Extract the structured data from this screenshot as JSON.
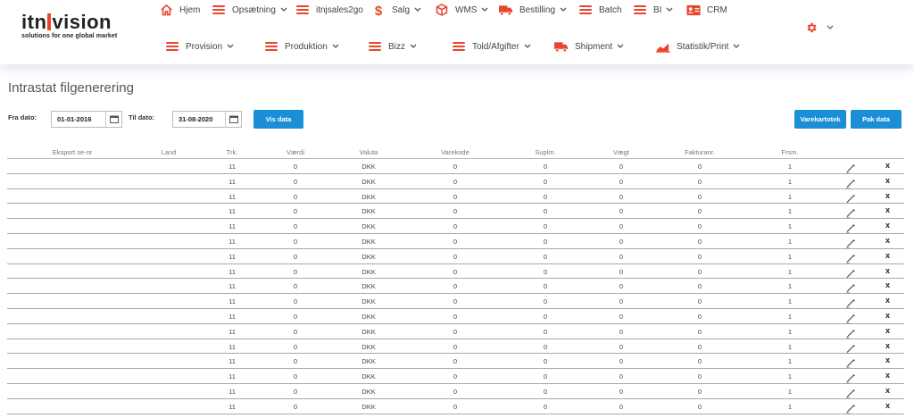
{
  "logo": {
    "brand_left": "itn",
    "brand_right": "vision",
    "tagline": "solutions for one global market"
  },
  "nav": {
    "row1": [
      {
        "label": "Hjem",
        "icon": "home-icon",
        "chevron": false
      },
      {
        "label": "Opsætning",
        "icon": "menu-icon",
        "chevron": true
      },
      {
        "label": "itnjsales2go",
        "icon": "menu-icon",
        "chevron": false
      },
      {
        "label": "Salg",
        "icon": "dollar-icon",
        "chevron": true
      },
      {
        "label": "WMS",
        "icon": "box-icon",
        "chevron": true
      },
      {
        "label": "Bestilling",
        "icon": "truck-icon",
        "chevron": true
      },
      {
        "label": "Batch",
        "icon": "menu-icon",
        "chevron": false
      },
      {
        "label": "BI",
        "icon": "menu-icon",
        "chevron": true
      },
      {
        "label": "CRM",
        "icon": "contact-card-icon",
        "chevron": false
      }
    ],
    "row2": [
      {
        "label": "Provision",
        "icon": "menu-icon",
        "chevron": true
      },
      {
        "label": "Produktion",
        "icon": "menu-icon",
        "chevron": true
      },
      {
        "label": "Bizz",
        "icon": "menu-icon",
        "chevron": true
      },
      {
        "label": "Told/Afgifter",
        "icon": "menu-icon",
        "chevron": true
      },
      {
        "label": "Shipment",
        "icon": "truck-icon",
        "chevron": true
      },
      {
        "label": "Statistik/Print",
        "icon": "chart-icon",
        "chevron": true
      }
    ]
  },
  "accent_color": "#e8452e",
  "button_color": "#1a8fd8",
  "page_title": "Intrastat filgenerering",
  "filters": {
    "from_label": "Fra dato:",
    "from_value": "01-01-2016",
    "to_label": "Til dato:",
    "to_value": "31-08-2020",
    "show_button": "Vis data",
    "varekartotek_button": "Varekartotek",
    "pak_button": "Pak data"
  },
  "table": {
    "headers": [
      "Eksport se-nr",
      "Land",
      "Trk.",
      "Værdi",
      "Valuta",
      "Varekode",
      "Suplm.",
      "Vægt",
      "Fakturanr.",
      "Frsm."
    ],
    "rows": [
      [
        "",
        "",
        "11",
        "0",
        "DKK",
        "0",
        "0",
        "0",
        "0",
        "1"
      ],
      [
        "",
        "",
        "11",
        "0",
        "DKK",
        "0",
        "0",
        "0",
        "0",
        "1"
      ],
      [
        "",
        "",
        "11",
        "0",
        "DKK",
        "0",
        "0",
        "0",
        "0",
        "1"
      ],
      [
        "",
        "",
        "11",
        "0",
        "DKK",
        "0",
        "0",
        "0",
        "0",
        "1"
      ],
      [
        "",
        "",
        "11",
        "0",
        "DKK",
        "0",
        "0",
        "0",
        "0",
        "1"
      ],
      [
        "",
        "",
        "11",
        "0",
        "DKK",
        "0",
        "0",
        "0",
        "0",
        "1"
      ],
      [
        "",
        "",
        "11",
        "0",
        "DKK",
        "0",
        "0",
        "0",
        "0",
        "1"
      ],
      [
        "",
        "",
        "11",
        "0",
        "DKK",
        "0",
        "0",
        "0",
        "0",
        "1"
      ],
      [
        "",
        "",
        "11",
        "0",
        "DKK",
        "0",
        "0",
        "0",
        "0",
        "1"
      ],
      [
        "",
        "",
        "11",
        "0",
        "DKK",
        "0",
        "0",
        "0",
        "0",
        "1"
      ],
      [
        "",
        "",
        "11",
        "0",
        "DKK",
        "0",
        "0",
        "0",
        "0",
        "1"
      ],
      [
        "",
        "",
        "11",
        "0",
        "DKK",
        "0",
        "0",
        "0",
        "0",
        "1"
      ],
      [
        "",
        "",
        "11",
        "0",
        "DKK",
        "0",
        "0",
        "0",
        "0",
        "1"
      ],
      [
        "",
        "",
        "11",
        "0",
        "DKK",
        "0",
        "0",
        "0",
        "0",
        "1"
      ],
      [
        "",
        "",
        "11",
        "0",
        "DKK",
        "0",
        "0",
        "0",
        "0",
        "1"
      ],
      [
        "",
        "",
        "11",
        "0",
        "DKK",
        "0",
        "0",
        "0",
        "0",
        "1"
      ],
      [
        "",
        "",
        "11",
        "0",
        "DKK",
        "0",
        "0",
        "0",
        "0",
        "1"
      ]
    ],
    "delete_glyph": "x"
  }
}
